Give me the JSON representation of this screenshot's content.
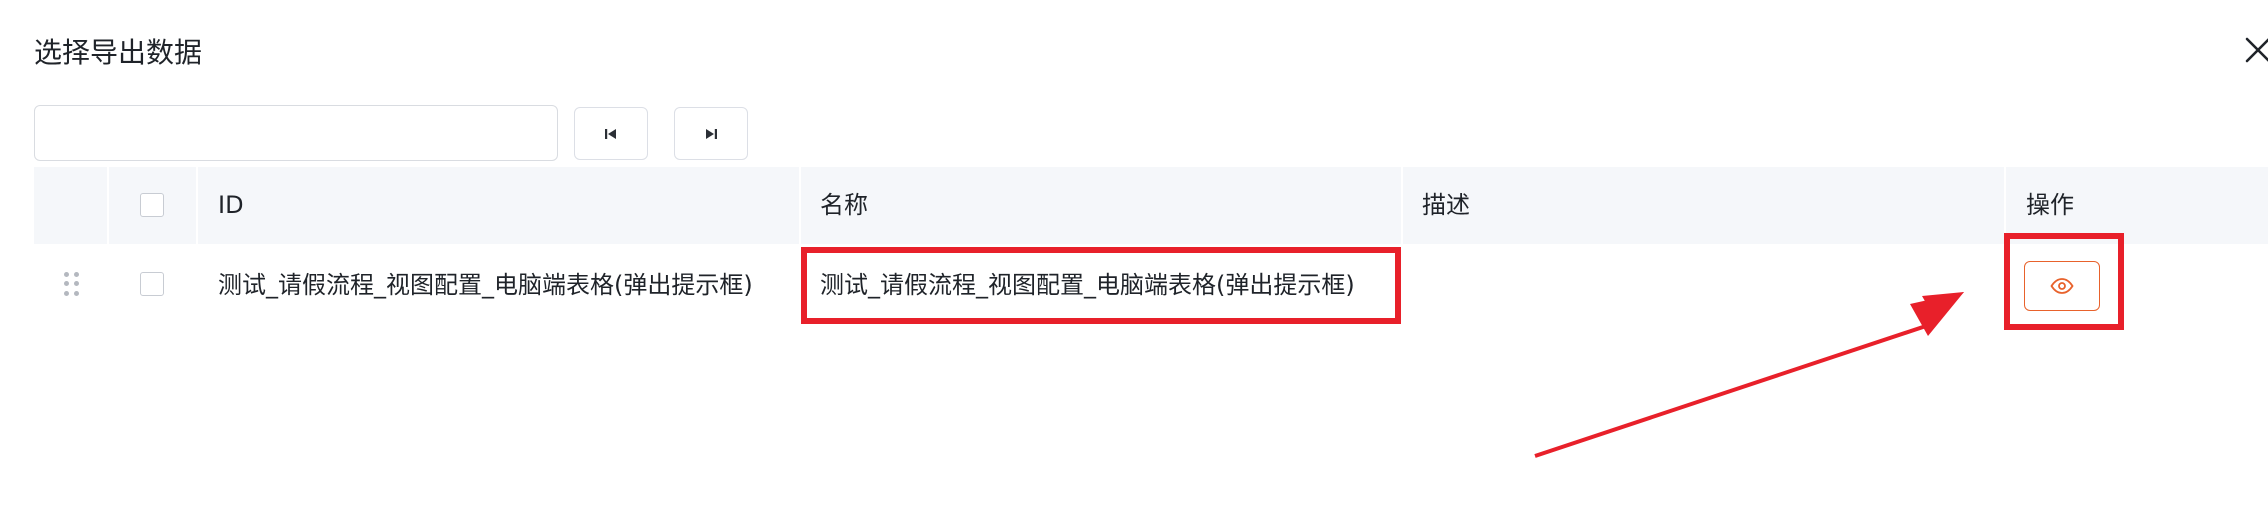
{
  "dialog": {
    "title": "选择导出数据",
    "close_icon": "close-icon"
  },
  "search": {
    "value": "",
    "placeholder": ""
  },
  "pager": {
    "first_icon": "skip-first-icon",
    "last_icon": "skip-last-icon"
  },
  "table": {
    "columns": [
      "ID",
      "名称",
      "描述",
      "操作"
    ],
    "rows": [
      {
        "id": "测试_请假流程_视图配置_电脑端表格(弹出提示框)",
        "name": "测试_请假流程_视图配置_电脑端表格(弹出提示框)",
        "description": "",
        "action_icon": "eye-icon"
      }
    ]
  },
  "colors": {
    "annotation_red": "#e8202a",
    "action_orange": "#e8622c",
    "header_bg": "#f5f7fa"
  }
}
